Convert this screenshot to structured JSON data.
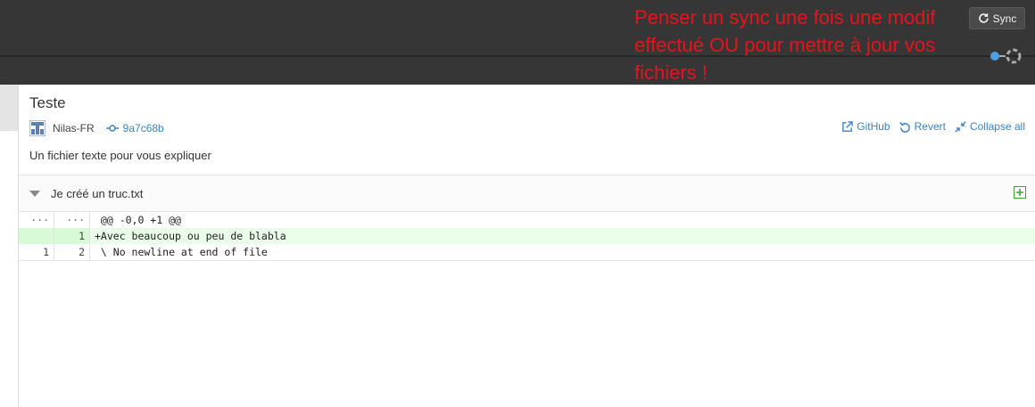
{
  "toolbar": {
    "sync_label": "Sync"
  },
  "annotation": {
    "text": "Penser un sync une fois une modif effectué OU pour mettre à jour vos fichiers !",
    "color": "#e8121c"
  },
  "commit": {
    "title": "Teste",
    "author": "Nilas-FR",
    "sha": "9a7c68b",
    "description": "Un fichier texte pour vous expliquer",
    "actions": {
      "github": "GitHub",
      "revert": "Revert",
      "collapse": "Collapse all"
    }
  },
  "file": {
    "name": "Je créé un truc.txt"
  },
  "diff": {
    "hunk": {
      "old": "···",
      "new": "···",
      "text": " @@ -0,0 +1 @@"
    },
    "lines": [
      {
        "old": "",
        "new": "1",
        "text": "+Avec beaucoup ou peu de blabla",
        "type": "added"
      },
      {
        "old": "1",
        "new": "2",
        "text": " \\ No newline at end of file",
        "type": "context"
      }
    ]
  },
  "colors": {
    "topbar": "#363636",
    "link": "#3a83c9",
    "added_bg": "#e9fde8",
    "accent_green": "#3aa535"
  }
}
